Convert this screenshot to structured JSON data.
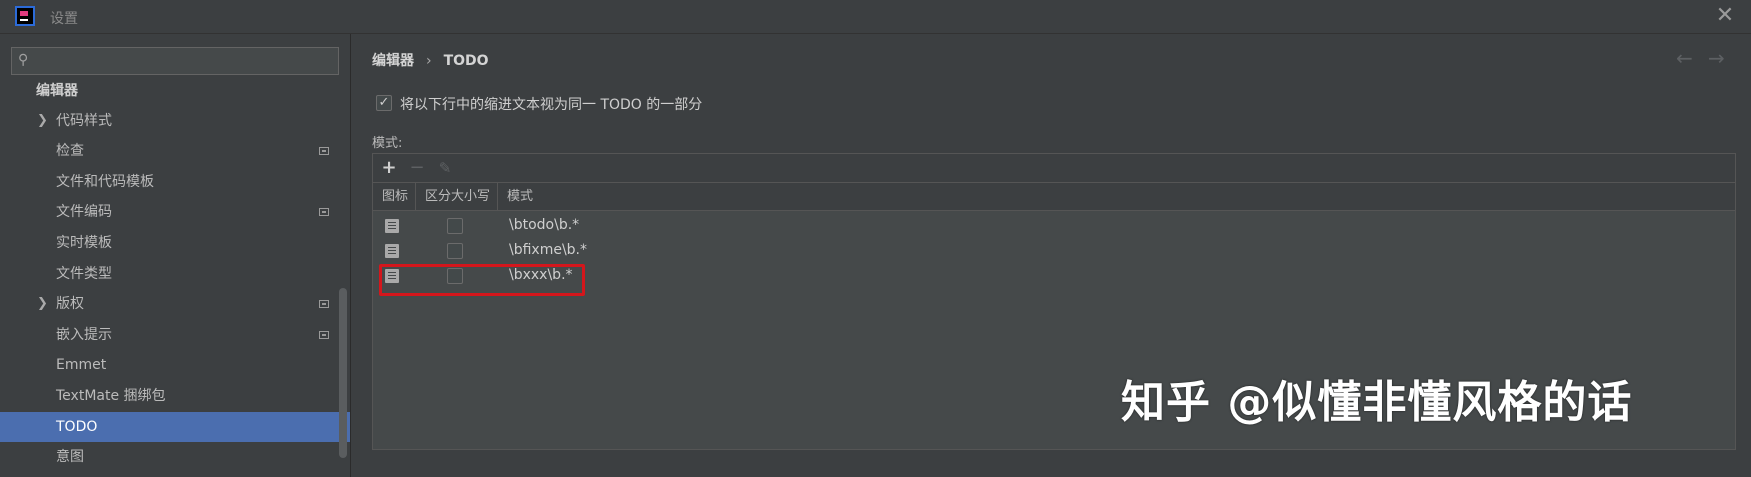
{
  "window": {
    "title": "设置",
    "close": "✕"
  },
  "sidebar": {
    "search": {
      "icon": "search-icon",
      "value": "",
      "placeholder": ""
    },
    "items": [
      {
        "label": "编辑器",
        "level": 0
      },
      {
        "label": "代码样式",
        "expandable": true
      },
      {
        "label": "检查",
        "badge": true
      },
      {
        "label": "文件和代码模板"
      },
      {
        "label": "文件编码",
        "badge": true
      },
      {
        "label": "实时模板"
      },
      {
        "label": "文件类型"
      },
      {
        "label": "版权",
        "expandable": true,
        "badge": true
      },
      {
        "label": "嵌入提示",
        "badge": true
      },
      {
        "label": "Emmet"
      },
      {
        "label": "TextMate 捆绑包"
      },
      {
        "label": "TODO",
        "selected": true
      },
      {
        "label": "意图"
      }
    ]
  },
  "main": {
    "breadcrumb": {
      "parent": "编辑器",
      "separator": "›",
      "current": "TODO"
    },
    "nav": {
      "back": "←",
      "forward": "→"
    },
    "option": {
      "checked": true,
      "check_glyph": "✓",
      "label": "将以下行中的缩进文本视为同一 TODO 的一部分"
    },
    "patterns_label": "模式:",
    "toolbar": {
      "add": "+",
      "remove": "−",
      "edit": "✎"
    },
    "table": {
      "headers": [
        "图标",
        "区分大小写",
        "模式"
      ],
      "rows": [
        {
          "pattern": "\\btodo\\b.*",
          "case_sensitive": false
        },
        {
          "pattern": "\\bfixme\\b.*",
          "case_sensitive": false
        },
        {
          "pattern": "\\bxxx\\b.*",
          "case_sensitive": false,
          "highlighted": true
        }
      ]
    }
  },
  "watermark": "知乎 @似懂非懂风格的话",
  "colors": {
    "accent": "#4b6eaf",
    "highlight": "#d4161c",
    "background": "#3c3f41"
  }
}
